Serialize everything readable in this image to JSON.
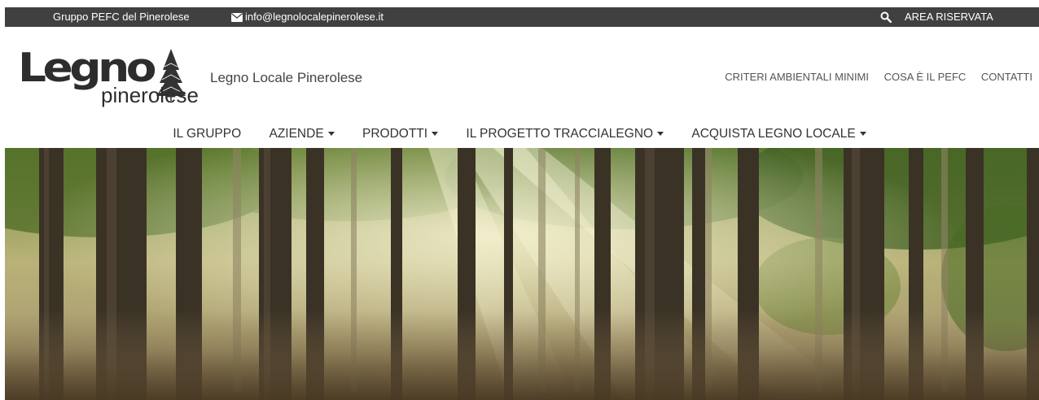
{
  "topbar": {
    "group_label": "Gruppo PEFC del Pinerolese",
    "email": "info@legnolocalepinerolese.it",
    "reserved_area": "AREA RISERVATA"
  },
  "header": {
    "logo_word_1": "Legno",
    "logo_word_2": "pinerolese",
    "site_title": "Legno Locale Pinerolese",
    "links": [
      "CRITERI AMBIENTALI MINIMI",
      "COSA È IL PEFC",
      "CONTATTI"
    ]
  },
  "nav": {
    "items": [
      {
        "label": "IL GRUPPO",
        "dropdown": false
      },
      {
        "label": "AZIENDE",
        "dropdown": true
      },
      {
        "label": "PRODOTTI",
        "dropdown": true
      },
      {
        "label": "IL PROGETTO TRACCIALEGNO",
        "dropdown": true
      },
      {
        "label": "ACQUISTA LEGNO LOCALE",
        "dropdown": true
      }
    ]
  },
  "colors": {
    "topbar_bg": "#404040",
    "text": "#333333"
  },
  "icons": {
    "email": "envelope-icon",
    "search": "search-icon",
    "dropdown": "caret-down-icon",
    "logo": "pine-tree-icon"
  }
}
